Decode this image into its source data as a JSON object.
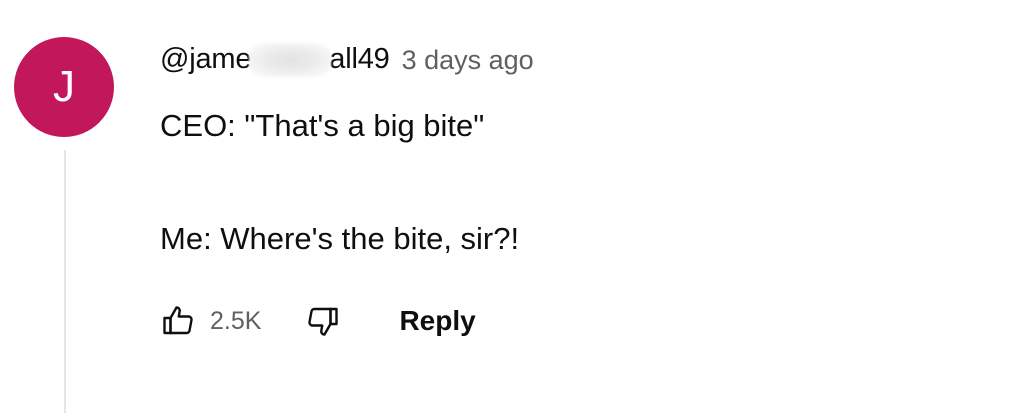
{
  "comment": {
    "avatar_initial": "J",
    "avatar_color": "#c2185b",
    "author_prefix": "@jame",
    "author_suffix": "all49",
    "timestamp": "3 days ago",
    "text_lines": [
      "CEO: \"That's a big bite\"",
      "Me: Where's the bite, sir?!"
    ],
    "likes": "2.5K",
    "like_icon": "thumbs-up-icon",
    "dislike_icon": "thumbs-down-icon",
    "reply_label": "Reply"
  }
}
